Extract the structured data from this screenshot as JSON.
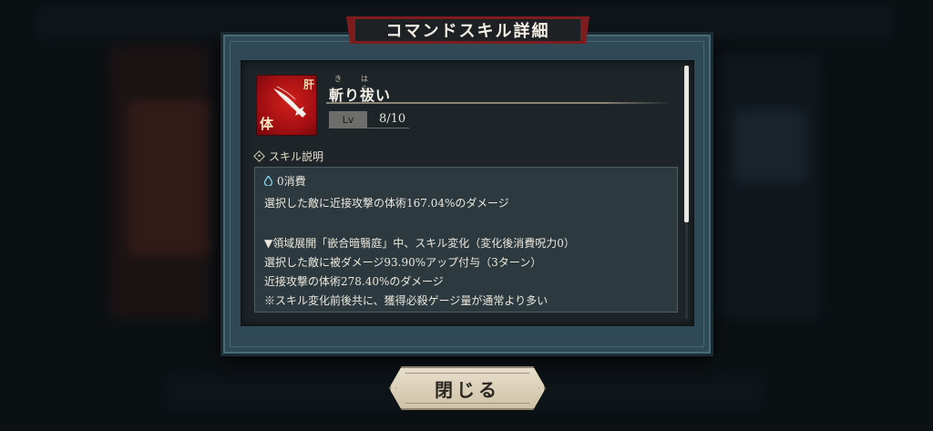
{
  "dialog": {
    "title": "コマンドスキル詳細",
    "close_label": "閉じる"
  },
  "skill": {
    "icon": "sword-slash-icon",
    "icon_corner_label": "肝",
    "icon_type_label": "体",
    "name": "斬り祓い",
    "ruby": {
      "ki": "き",
      "hara": "はら"
    },
    "level_label": "Lv",
    "level_value": "8/10"
  },
  "description": {
    "section_title": "スキル説明",
    "cost_text": "0消費",
    "lines": [
      "選択した敵に近接攻撃の体術167.04%のダメージ",
      "",
      "▼領域展開「嵌合暗翳庭」中、スキル変化（変化後消費呪力0）",
      "選択した敵に被ダメージ93.90%アップ付与（3ターン）",
      "近接攻撃の体術278.40%のダメージ",
      "※スキル変化前後共に、獲得必殺ゲージ量が通常より多い"
    ]
  },
  "colors": {
    "ribbon_red": "#7d1c1f",
    "icon_red": "#d2201c",
    "frame_teal": "#2f4a56"
  }
}
